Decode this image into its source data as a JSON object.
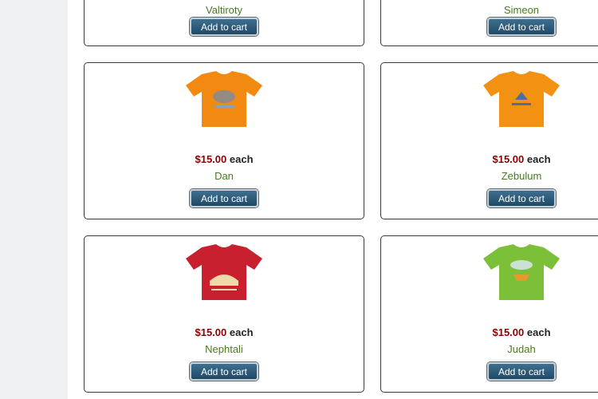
{
  "currency_suffix": "each",
  "button_label": "Add to cart",
  "top_row": [
    {
      "name": "Valtiroty"
    },
    {
      "name": "Simeon"
    }
  ],
  "products": [
    {
      "name": "Dan",
      "price": "$15.00",
      "each": "each",
      "shirt_color": "#f28a12",
      "print_color": "#6b8bb0"
    },
    {
      "name": "Zebulum",
      "price": "$15.00",
      "each": "each",
      "shirt_color": "#f39212",
      "print_color": "#4f6f9a"
    },
    {
      "name": "Nephtali",
      "price": "$15.00",
      "each": "each",
      "shirt_color": "#c8202e",
      "print_color": "#f0d9a8"
    },
    {
      "name": "Judah",
      "price": "$15.00",
      "each": "each",
      "shirt_color": "#7cc03a",
      "print_color": "#d9e6f0"
    }
  ]
}
